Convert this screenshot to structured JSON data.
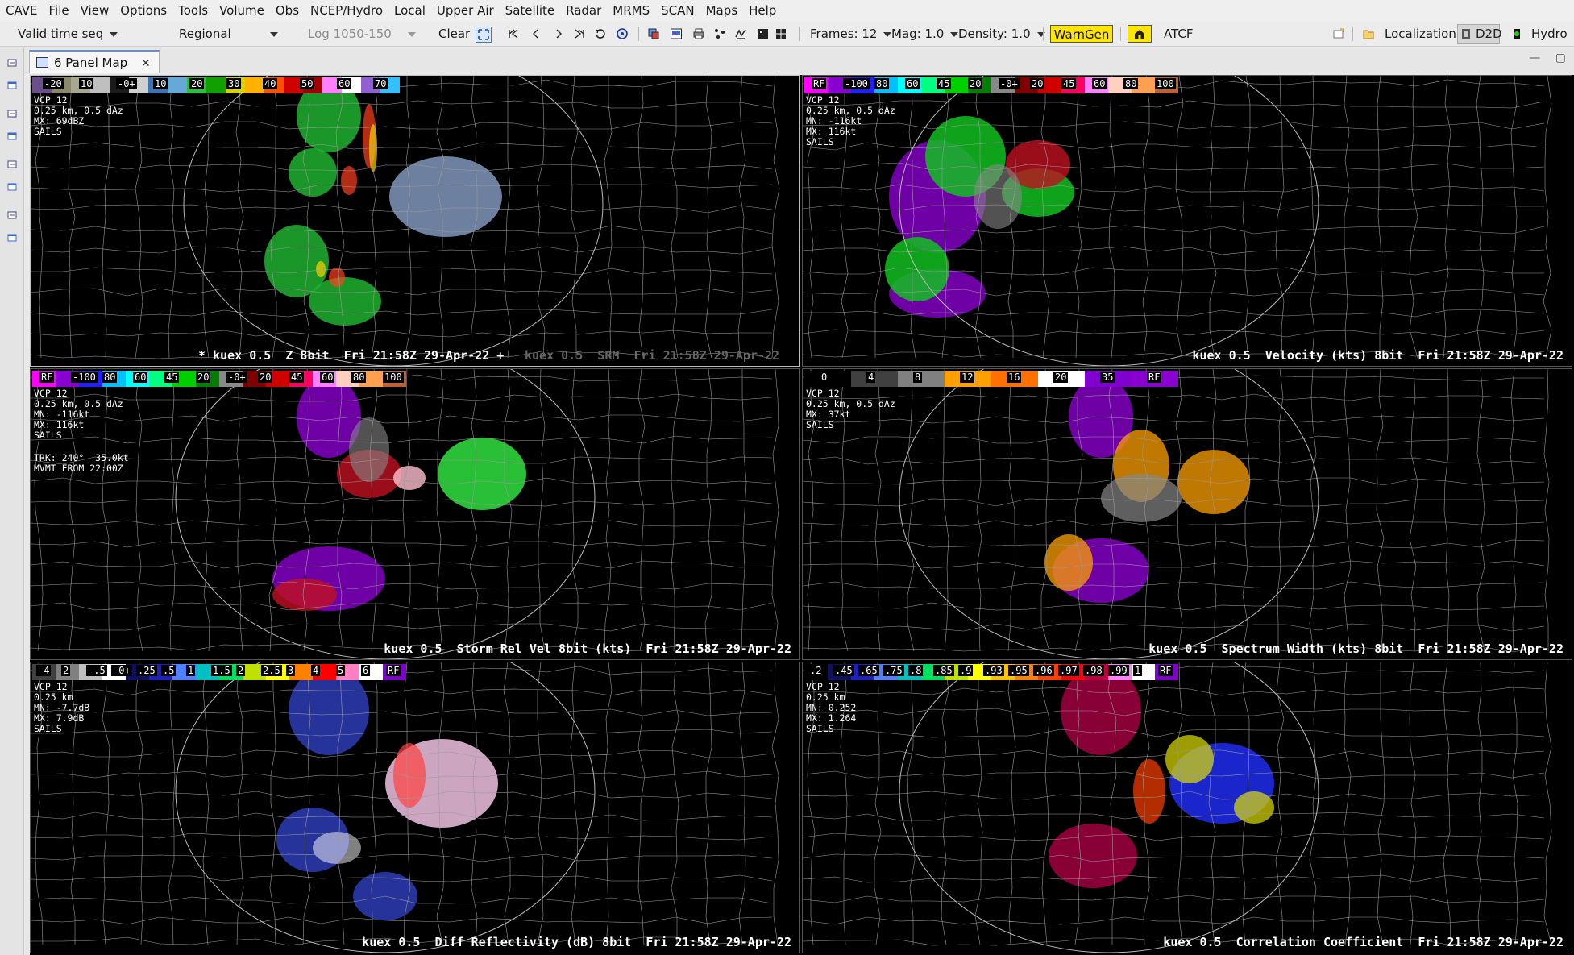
{
  "app": {
    "title": "CAVE"
  },
  "menu": [
    "CAVE",
    "File",
    "View",
    "Options",
    "Tools",
    "Volume",
    "Obs",
    "NCEP/Hydro",
    "Local",
    "Upper Air",
    "Satellite",
    "Radar",
    "MRMS",
    "SCAN",
    "Maps",
    "Help"
  ],
  "toolbar": {
    "time_mode": "Valid time seq",
    "scale": "Regional",
    "load_mode": "Log 1050-150",
    "clear": "Clear",
    "frames": "Frames: 12",
    "mag": "Mag: 1.0",
    "density": "Density: 1.0",
    "warngen": "WarnGen",
    "atcf": "ATCF",
    "localization": "Localization",
    "d2d": "D2D",
    "hydro": "Hydro"
  },
  "editor": {
    "tab_label": "6 Panel Map",
    "close": "✕",
    "minimize": "—",
    "maximize": "▢"
  },
  "colors": {
    "accent_yellow": "#ffe600",
    "map_bg": "#000000",
    "county_lines": "#9a9a9a"
  },
  "panels": [
    {
      "id": "reflectivity",
      "info": "VCP 12\n0.25 km, 0.5 dAz\nMX: 69dBZ\nSAILS",
      "title": "* kuex 0.5  Z 8bit  Fri 21:58Z 29-Apr-22 +",
      "title2": "kuex 0.5  SRM  Fri 21:58Z 29-Apr-22",
      "colorbar": {
        "labels": [
          "-20",
          "10",
          "-0+",
          "10",
          "20",
          "30",
          "40",
          "50",
          "60",
          "70"
        ],
        "colors": [
          "#6b4f8a",
          "#8a8a6a",
          "#a8a890",
          "#bfbfbf",
          "#1a1a1a",
          "#cfcfcf",
          "#3a74b5",
          "#66a8d8",
          "#29c23a",
          "#10a000",
          "#d4d400",
          "#ffb000",
          "#ff5000",
          "#d00000",
          "#a00000",
          "#ff80ff",
          "#ffffff",
          "#9060d0",
          "#30c0ff"
        ]
      }
    },
    {
      "id": "velocity",
      "info": "VCP 12\n0.25 km, 0.5 dAz\nMN: -116kt\nMX: 116kt\nSAILS",
      "title": "kuex 0.5  Velocity (kts) 8bit  Fri 21:58Z 29-Apr-22",
      "colorbar": {
        "labels": [
          "RF",
          "-100",
          "80",
          "60",
          "45",
          "20",
          "-0+",
          "20",
          "45",
          "60",
          "80",
          "100"
        ],
        "colors": [
          "#ff00ff",
          "#8a00d0",
          "#2020ff",
          "#00c0ff",
          "#00ffff",
          "#00ff80",
          "#00d000",
          "#008000",
          "#888888",
          "#800000",
          "#d00000",
          "#ff0060",
          "#ff80ff",
          "#ffd0c0",
          "#ffa050",
          "#c06030"
        ]
      }
    },
    {
      "id": "srm",
      "info": "VCP 12\n0.25 km, 0.5 dAz\nMN: -116kt\nMX: 116kt\nSAILS",
      "info2": "TRK: 240°  35.0kt\nMVMT FROM 22:00Z",
      "title": "kuex 0.5  Storm Rel Vel 8bit (kts)  Fri 21:58Z 29-Apr-22",
      "colorbar": {
        "labels": [
          "RF",
          "-100",
          "80",
          "60",
          "45",
          "20",
          "-0+",
          "20",
          "45",
          "60",
          "80",
          "100"
        ],
        "colors": [
          "#ff00ff",
          "#8a00d0",
          "#2020ff",
          "#00c0ff",
          "#00ffff",
          "#00ff80",
          "#00d000",
          "#008000",
          "#888888",
          "#800000",
          "#d00000",
          "#ff0060",
          "#ff80ff",
          "#ffd0c0",
          "#ffa050",
          "#c06030"
        ]
      }
    },
    {
      "id": "spectrum-width",
      "info": "VCP 12\n0.25 km, 0.5 dAz\nMX: 37kt\nSAILS",
      "title": "kuex 0.5  Spectrum Width (kts) 8bit  Fri 21:58Z 29-Apr-22",
      "colorbar": {
        "labels": [
          "0",
          "4",
          "8",
          "12",
          "16",
          "20",
          "35",
          "RF"
        ],
        "colors": [
          "#000000",
          "#404040",
          "#808080",
          "#ffa000",
          "#ff7000",
          "#ffffff",
          "#8000d0",
          "#8a00d0"
        ]
      }
    },
    {
      "id": "diff-reflectivity",
      "info": "VCP 12\n0.25 km\nMN: -7.7dB\nMX: 7.9dB\nSAILS",
      "title": "kuex 0.5  Diff Reflectivity (dB) 8bit  Fri 21:58Z 29-Apr-22",
      "colorbar": {
        "labels": [
          "-4",
          "2",
          "-.5",
          "-0+",
          ".25",
          ".5",
          "1",
          "1.5",
          "2",
          "2.5",
          "3",
          "4",
          "5",
          "6",
          "RF"
        ],
        "colors": [
          "#404040",
          "#808080",
          "#c0c0c0",
          "#ffffff",
          "#101060",
          "#2020c0",
          "#5080ff",
          "#00c0c0",
          "#00e060",
          "#c0e000",
          "#ffff00",
          "#ff8000",
          "#ff0000",
          "#ff80c0",
          "#ffffff",
          "#8000d0"
        ]
      }
    },
    {
      "id": "correlation-coefficient",
      "info": "VCP 12\n0.25 km\nMN: 0.252\nMX: 1.264\nSAILS",
      "title": "kuex 0.5  Correlation Coefficient  Fri 21:58Z 29-Apr-22",
      "colorbar": {
        "labels": [
          ".2",
          ".45",
          ".65",
          ".75",
          ".8",
          ".85",
          ".9",
          ".93",
          ".95",
          ".96",
          ".97",
          ".98",
          ".99",
          "1",
          "RF"
        ],
        "colors": [
          "#000000",
          "#101060",
          "#2020c0",
          "#5080ff",
          "#00c0c0",
          "#00e060",
          "#c0e000",
          "#ffff00",
          "#ffc000",
          "#ff8000",
          "#ff4000",
          "#ff0000",
          "#c00040",
          "#ff80ff",
          "#ffffff",
          "#8000d0"
        ]
      }
    }
  ]
}
